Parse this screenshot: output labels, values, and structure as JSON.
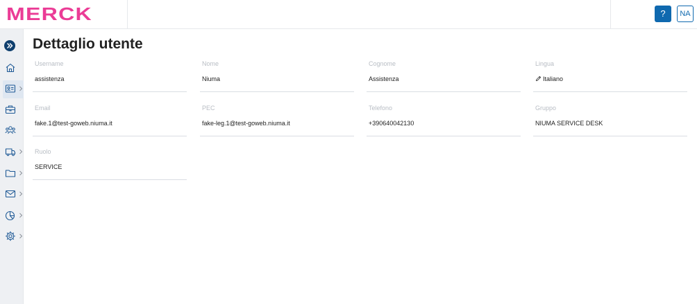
{
  "header": {
    "logo_text": "MERCK",
    "help_label": "?",
    "user_initials": "NA"
  },
  "colors": {
    "brand_magenta": "#eb3c96",
    "primary_blue": "#0f69af",
    "sidebar_bg": "#eef0f3"
  },
  "sidebar": {
    "items": [
      {
        "icon": "home-icon"
      },
      {
        "icon": "id-card-icon"
      },
      {
        "icon": "briefcase-icon"
      },
      {
        "icon": "users-icon"
      },
      {
        "icon": "truck-icon"
      },
      {
        "icon": "folder-icon"
      },
      {
        "icon": "mail-icon"
      },
      {
        "icon": "pie-chart-icon"
      },
      {
        "icon": "gear-icon"
      }
    ]
  },
  "page": {
    "title": "Dettaglio utente"
  },
  "fields": {
    "username": {
      "label": "Username",
      "value": "assistenza"
    },
    "nome": {
      "label": "Nome",
      "value": "Niuma"
    },
    "cognome": {
      "label": "Cognome",
      "value": "Assistenza"
    },
    "lingua": {
      "label": "Lingua",
      "value": "Italiano"
    },
    "email": {
      "label": "Email",
      "value": "fake.1@test-goweb.niuma.it"
    },
    "pec": {
      "label": "PEC",
      "value": "fake-leg.1@test-goweb.niuma.it"
    },
    "telefono": {
      "label": "Telefono",
      "value": "+390640042130"
    },
    "gruppo": {
      "label": "Gruppo",
      "value": "NIUMA SERVICE DESK"
    },
    "ruolo": {
      "label": "Ruolo",
      "value": "SERVICE"
    }
  }
}
